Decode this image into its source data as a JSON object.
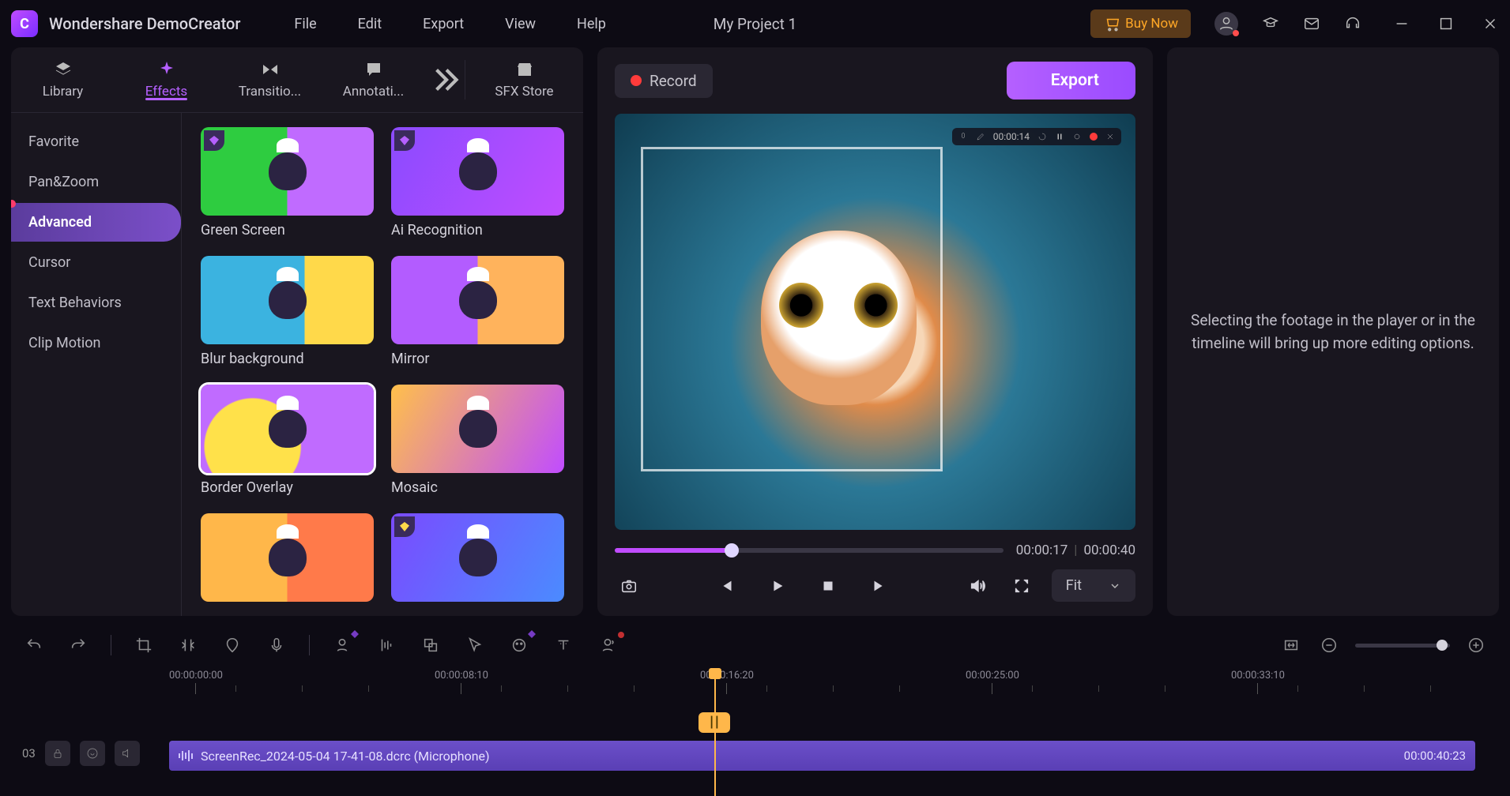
{
  "app_title": "Wondershare DemoCreator",
  "menu": {
    "file": "File",
    "edit": "Edit",
    "export": "Export",
    "view": "View",
    "help": "Help"
  },
  "project_name": "My Project 1",
  "buy_now": "Buy Now",
  "main_tabs": {
    "library": "Library",
    "effects": "Effects",
    "transitions": "Transitio...",
    "annotations": "Annotati...",
    "sfx_store": "SFX Store"
  },
  "effects_sidebar": {
    "favorite": "Favorite",
    "panzoom": "Pan&Zoom",
    "advanced": "Advanced",
    "cursor": "Cursor",
    "text_behaviors": "Text Behaviors",
    "clip_motion": "Clip Motion"
  },
  "effects": {
    "green_screen": "Green Screen",
    "ai_recognition": "Ai Recognition",
    "blur_background": "Blur background",
    "mirror": "Mirror",
    "border_overlay": "Border Overlay",
    "mosaic": "Mosaic"
  },
  "record_label": "Record",
  "export_label": "Export",
  "rec_overlay_time": "00:00:14",
  "preview": {
    "current": "00:00:17",
    "total": "00:00:40",
    "fit": "Fit"
  },
  "inspector_hint": "Selecting the footage in the player or in the timeline will bring up more editing options.",
  "ruler": {
    "t0": "00:00:00:00",
    "t1": "00:00:08:10",
    "t2": "00:00:16:20",
    "t3": "00:00:25:00",
    "t4": "00:00:33:10"
  },
  "clip": {
    "name": "ScreenRec_2024-05-04 17-41-08.dcrc (Microphone)",
    "duration": "00:00:40:23"
  },
  "track_index": "03"
}
